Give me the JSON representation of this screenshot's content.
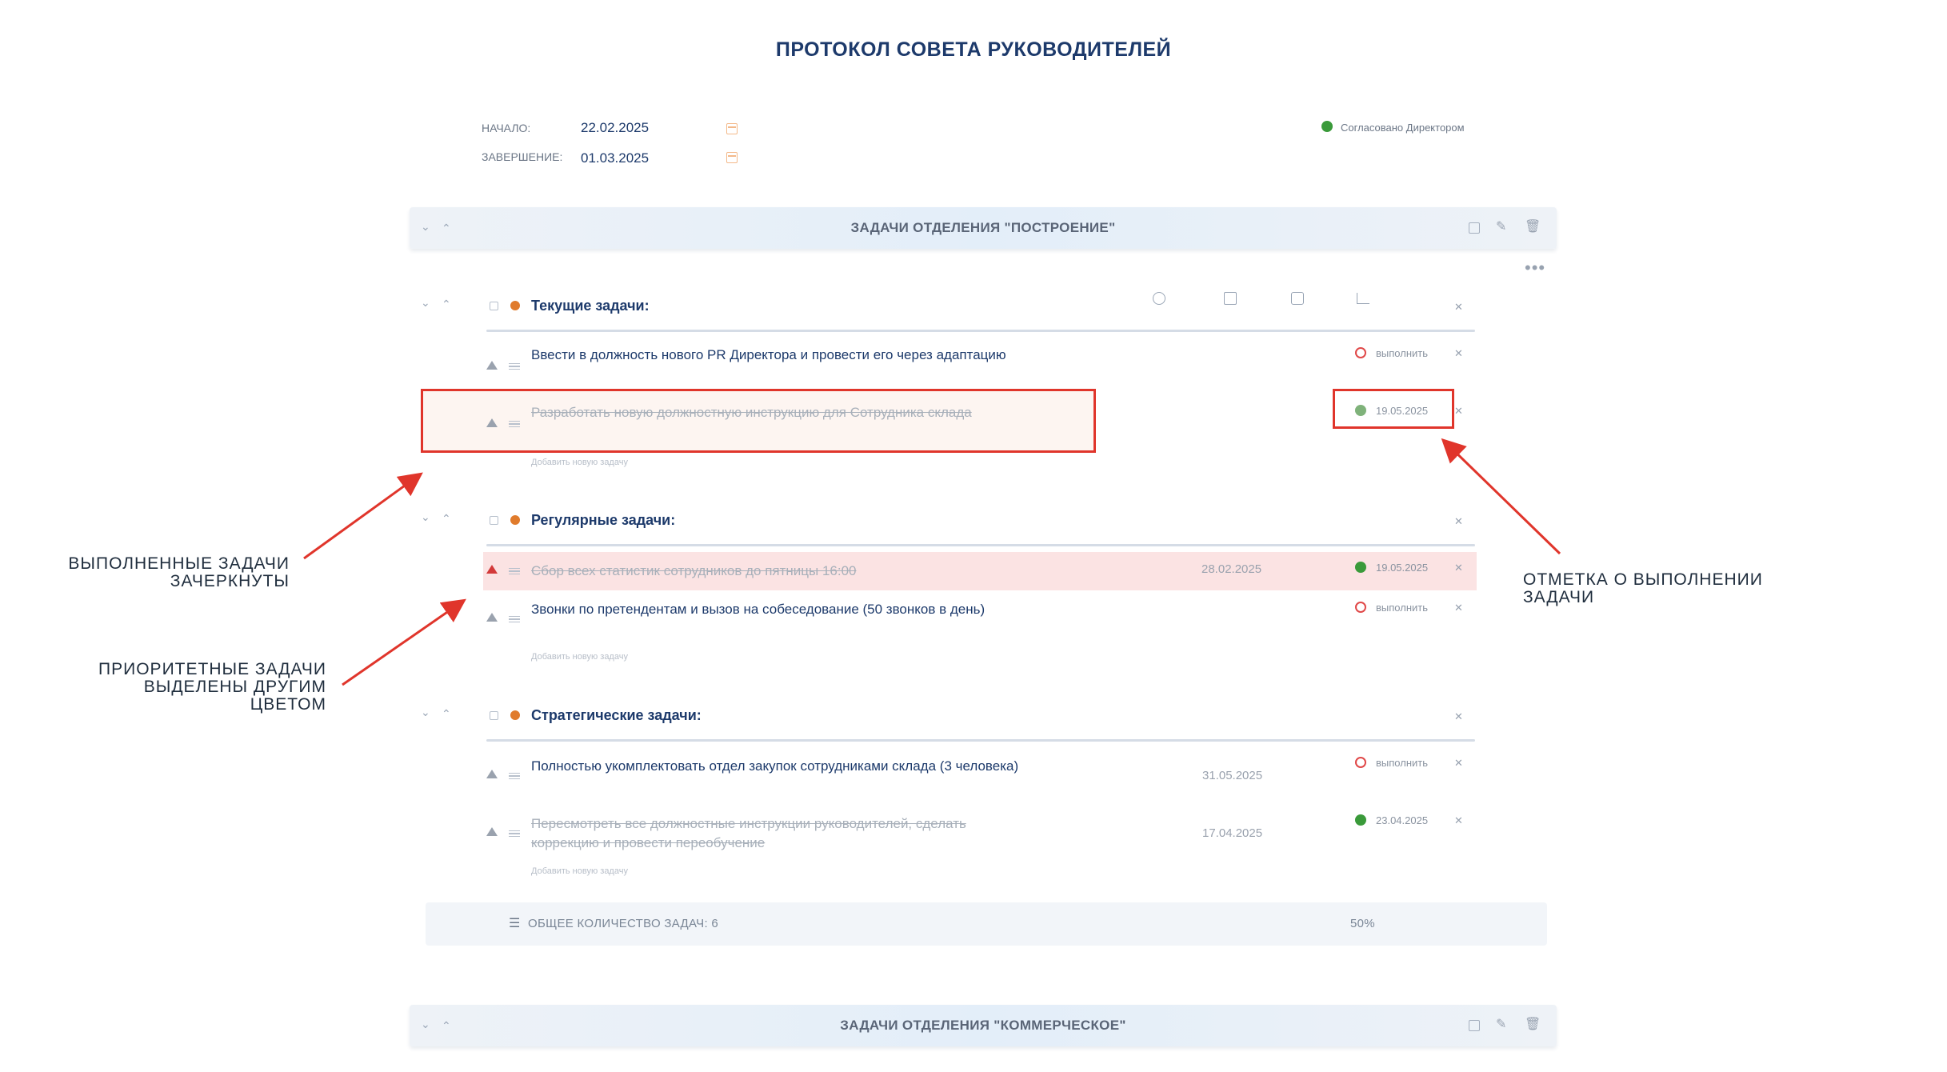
{
  "page_title": "ПРОТОКОЛ СОВЕТА РУКОВОДИТЕЛЕЙ",
  "meta": {
    "start_label": "НАЧАЛО:",
    "start_value": "22.02.2025",
    "end_label": "ЗАВЕРШЕНИЕ:",
    "end_value": "01.03.2025",
    "status": "Согласовано Директором",
    "status_color": "#3a9a3a"
  },
  "department_1": {
    "title": "ЗАДАЧИ ОТДЕЛЕНИЯ \"ПОСТРОЕНИЕ\"",
    "groups": [
      {
        "title": "Текущие задачи:",
        "tasks": [
          {
            "text": "Ввести в должность нового PR Директора и провести его через адаптацию",
            "state": "выполнить"
          },
          {
            "text": "Разработать новую должностную инструкцию для Сотрудника склада",
            "state": "19.05.2025"
          }
        ],
        "add": "Добавить новую задачу"
      },
      {
        "title": "Регулярные задачи:",
        "tasks": [
          {
            "text": "Сбор всех статистик сотрудников до пятницы 16:00",
            "date": "28.02.2025",
            "state": "19.05.2025"
          },
          {
            "text": "Звонки по претендентам и вызов на собеседование (50 звонков в день)",
            "state": "выполнить"
          }
        ],
        "add": "Добавить новую задачу"
      },
      {
        "title": "Стратегические задачи:",
        "tasks": [
          {
            "text": "Полностью укомплектовать отдел закупок сотрудниками склада (3 человека)",
            "date": "31.05.2025",
            "state": "выполнить"
          },
          {
            "text": "Пересмотреть все должностные инструкции руководителей, сделать коррекцию и провести переобучение",
            "date": "17.04.2025",
            "state": "23.04.2025"
          }
        ],
        "add": "Добавить новую задачу"
      }
    ],
    "summary_label": "ОБЩЕЕ КОЛИЧЕСТВО ЗАДАЧ: 6",
    "summary_percent": "50%"
  },
  "department_2": {
    "title": "ЗАДАЧИ ОТДЕЛЕНИЯ \"КОММЕРЧЕСКОЕ\""
  },
  "annotations": {
    "done_strike_1": "ВЫПОЛНЕННЫЕ ЗАДАЧИ",
    "done_strike_2": "ЗАЧЕРКНУТЫ",
    "priority_1": "ПРИОРИТЕТНЫЕ ЗАДАЧИ",
    "priority_2": "ВЫДЕЛЕНЫ ДРУГИМ",
    "priority_3": "ЦВЕТОМ",
    "mark_1": "ОТМЕТКА О ВЫПОЛНЕНИИ",
    "mark_2": "ЗАДАЧИ"
  },
  "colors": {
    "accent_orange": "#e07b2c",
    "done_green": "#3a9a3a",
    "todo_red": "#e04848",
    "annotation_red": "#e0352b",
    "priority_bg": "#fbe3e3"
  }
}
